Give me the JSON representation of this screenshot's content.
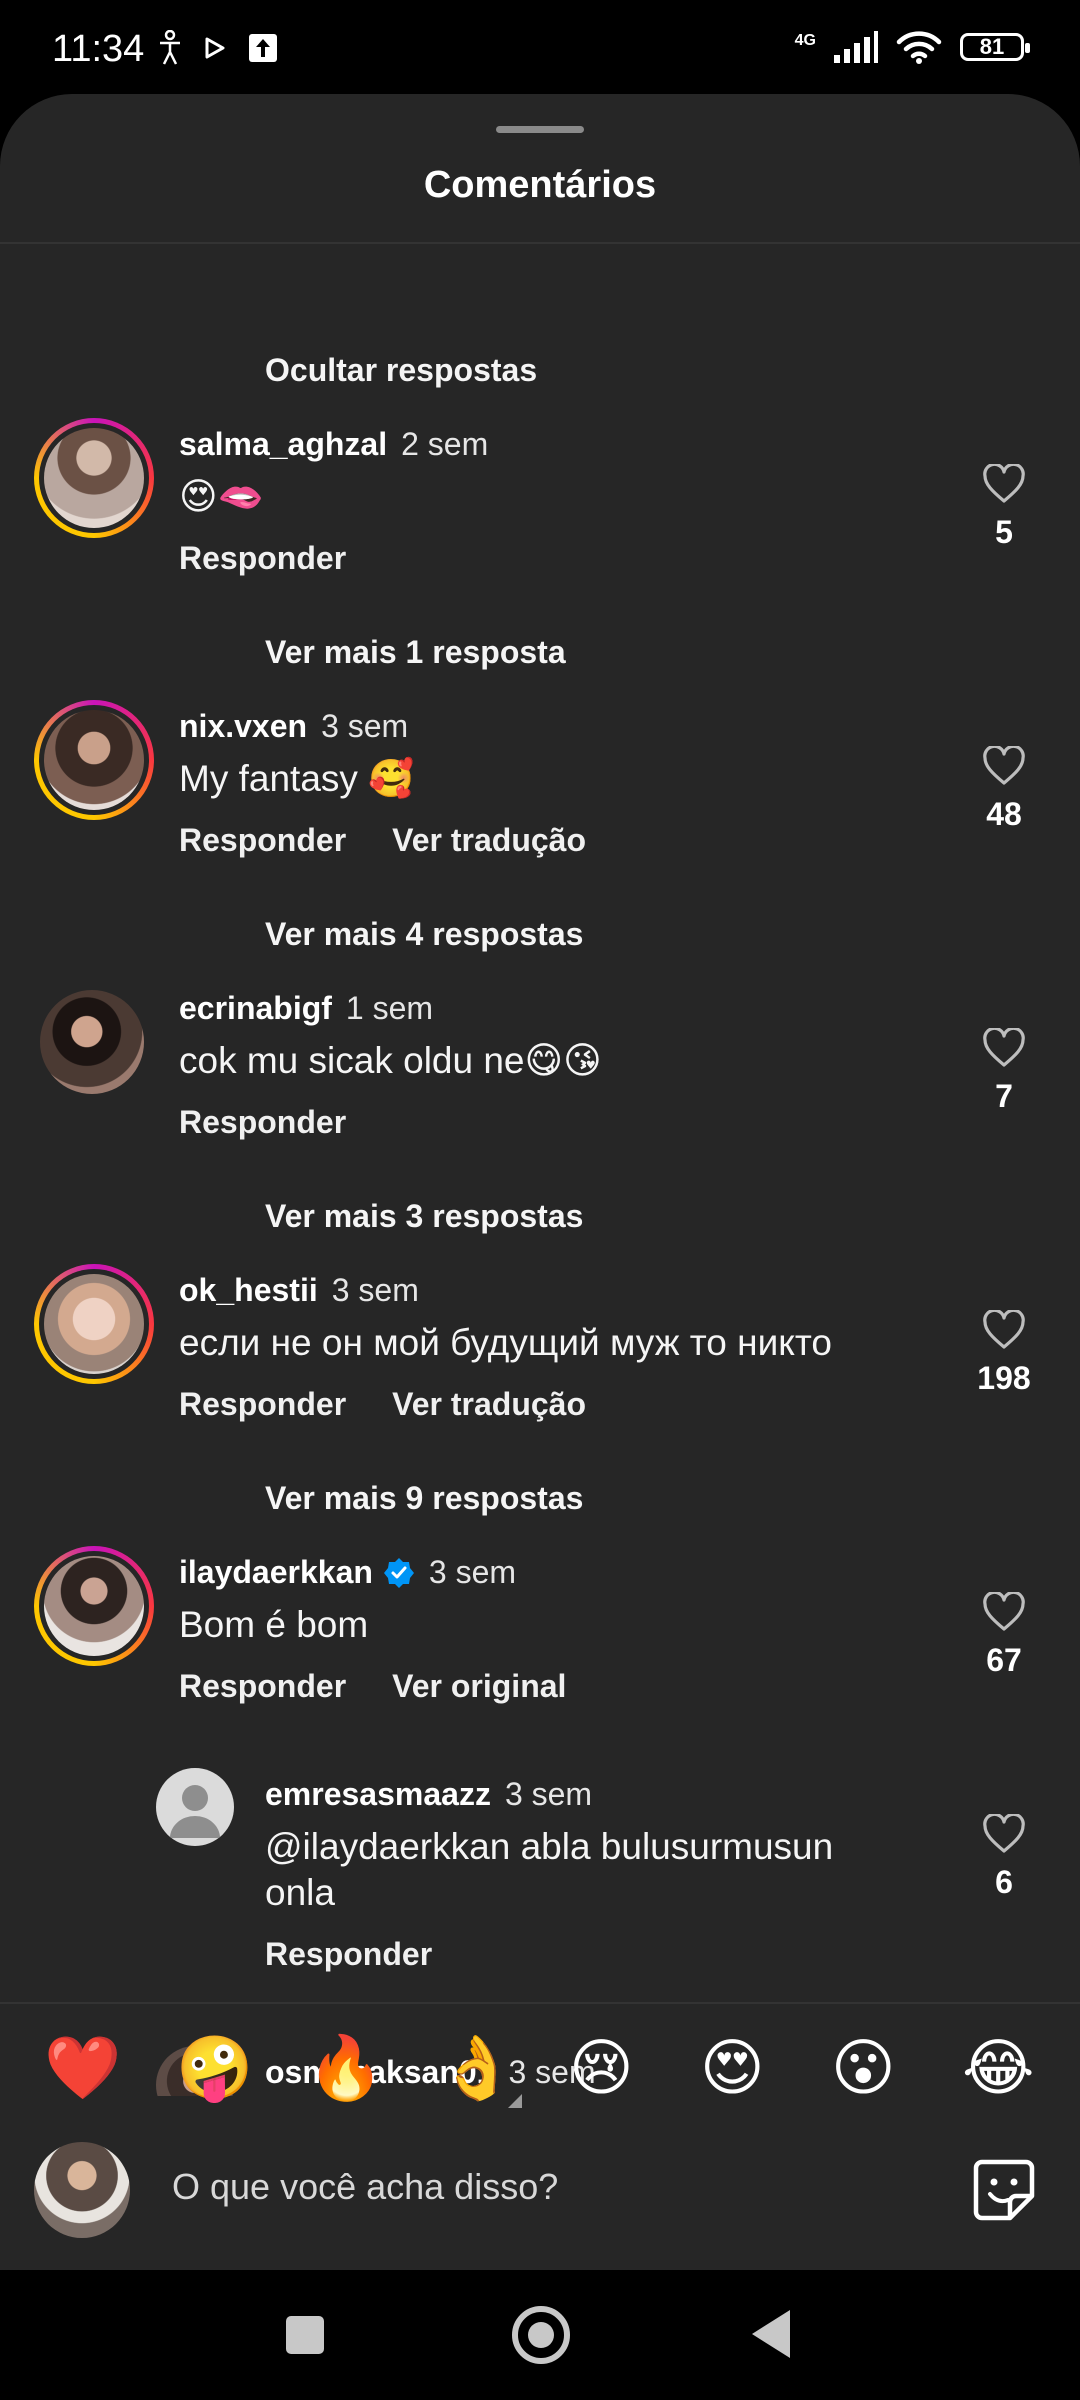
{
  "status": {
    "time": "11:34",
    "network": "4G",
    "battery": "81"
  },
  "sheet": {
    "title": "Comentários"
  },
  "comments": [
    {
      "hide_replies": "Ocultar respostas"
    },
    {
      "username": "salma_aghzal",
      "time": "2 sem",
      "text": "😍🫦",
      "reply": "Responder",
      "likes": "5",
      "more_replies": "Ver mais 1 resposta"
    },
    {
      "username": "nix.vxen",
      "time": "3 sem",
      "text": "My fantasy 🥰",
      "reply": "Responder",
      "translate": "Ver tradução",
      "likes": "48",
      "more_replies": "Ver mais 4 respostas"
    },
    {
      "username": "ecrinabigf",
      "time": "1 sem",
      "text": "cok mu sicak oldu ne😋😘",
      "reply": "Responder",
      "likes": "7",
      "more_replies": "Ver mais 3 respostas"
    },
    {
      "username": "ok_hestii",
      "time": "3 sem",
      "text": "если не он мой будущий муж то никто",
      "reply": "Responder",
      "translate": "Ver tradução",
      "likes": "198",
      "more_replies": "Ver mais 9 respostas"
    },
    {
      "username": "ilaydaerkkan",
      "time": "3 sem",
      "text": "Bom é bom",
      "reply": "Responder",
      "translate": "Ver original",
      "likes": "67"
    },
    {
      "username": "emresasmaazz",
      "time": "3 sem",
      "text": "@ilaydaerkkan abla bulusurmusun onla",
      "reply": "Responder",
      "likes": "6"
    },
    {
      "username": "osmanaksan01",
      "time": "3 sem"
    }
  ],
  "reactions": [
    "❤️",
    "🤪",
    "🔥",
    "👌",
    "😢",
    "😍",
    "😮",
    "😂"
  ],
  "composer": {
    "placeholder": "O que você acha disso?"
  }
}
